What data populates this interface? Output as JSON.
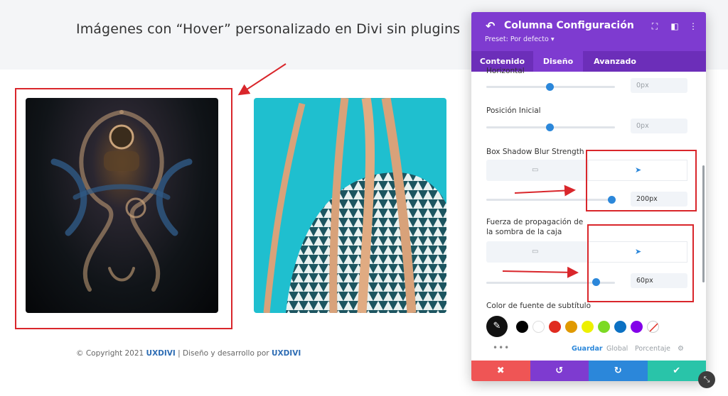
{
  "page": {
    "title": "Imágenes con “Hover” personalizado en Divi sin plugins",
    "footer": {
      "prefix": "© Copyright 2021 ",
      "brand": "UXDIVI",
      "middle": " | Diseño y desarrollo por ",
      "author": "UXDIVI"
    }
  },
  "panel": {
    "back_icon": "arrow-back-icon",
    "title": "Columna Configuración",
    "preset": "Preset: Por defecto ▾",
    "header_icons": [
      "expand-icon",
      "split-view-icon",
      "more-vertical-icon"
    ],
    "tabs": [
      {
        "label": "Contenido",
        "active": false
      },
      {
        "label": "Diseño",
        "active": true
      },
      {
        "label": "Avanzado",
        "active": false
      }
    ],
    "settings": {
      "horizontal": {
        "label": "Horizontal",
        "value": "0px",
        "level": 0.5
      },
      "posicion_inicial": {
        "label": "Posición Inicial",
        "value": "0px",
        "level": 0.5
      },
      "blur_strength": {
        "label": "Box Shadow Blur Strength",
        "value": "200px",
        "level": 1.0
      },
      "spread": {
        "label": "Fuerza de propagación de la sombra de la caja",
        "value": "60px",
        "level": 0.85
      },
      "subtitle_color": {
        "label": "Color de fuente de subtítulo"
      }
    },
    "swatches": [
      "#000000",
      "#ffffff",
      "#e02b20",
      "#e09900",
      "#edf000",
      "#7cda24",
      "#0c71c3",
      "#8300e9"
    ],
    "palette_tabs": [
      "Guardar",
      "Global",
      "Porcentaje"
    ],
    "actions": [
      {
        "name": "cancel",
        "glyph": "✖",
        "color": "#ef5555"
      },
      {
        "name": "undo",
        "glyph": "↺",
        "color": "#7e3bd0"
      },
      {
        "name": "redo",
        "glyph": "↻",
        "color": "#2b87da"
      },
      {
        "name": "save",
        "glyph": "✔",
        "color": "#29c4a9"
      }
    ]
  },
  "colors": {
    "divi_purple": "#7e3bd0",
    "divi_blue": "#2b87da",
    "annotation_red": "#d9262b"
  }
}
